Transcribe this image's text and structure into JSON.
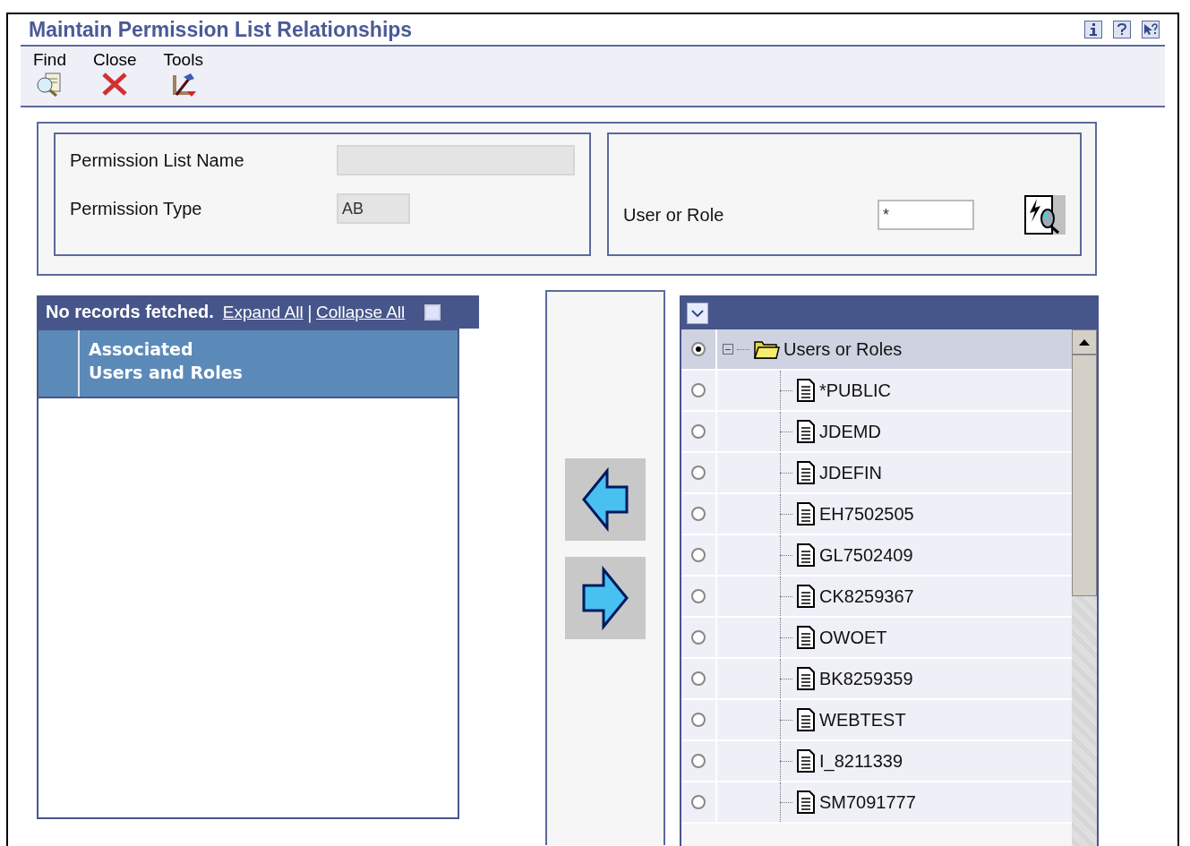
{
  "window": {
    "title": "Maintain Permission List Relationships"
  },
  "header_icons": [
    {
      "kind": "info"
    },
    {
      "kind": "help"
    },
    {
      "kind": "whats-this"
    }
  ],
  "toolbar": [
    {
      "label": "Find",
      "kind": "find"
    },
    {
      "label": "Close",
      "kind": "close"
    },
    {
      "label": "Tools",
      "kind": "tools"
    }
  ],
  "form": {
    "permission_list_name": {
      "label": "Permission List Name",
      "disabled": true
    },
    "permission_type": {
      "label": "Permission Type",
      "value": "AB",
      "disabled": true
    },
    "user_or_role": {
      "label": "User or Role",
      "value": "*"
    }
  },
  "grid": {
    "status": "No records fetched.",
    "links": [
      "Expand All",
      "Collapse All"
    ],
    "separator": "|",
    "columns": [
      "Associated\nUsers and Roles"
    ]
  },
  "tree": {
    "label": "Users or Roles",
    "selected": true,
    "expanded": true,
    "children": [
      {
        "label": "*PUBLIC",
        "selected": false
      },
      {
        "label": "JDEMD",
        "selected": false
      },
      {
        "label": "JDEFIN",
        "selected": false
      },
      {
        "label": "EH7502505",
        "selected": false
      },
      {
        "label": "GL7502409",
        "selected": false
      },
      {
        "label": "CK8259367",
        "selected": false
      },
      {
        "label": "OWOET",
        "selected": false
      },
      {
        "label": "BK8259359",
        "selected": false
      },
      {
        "label": "WEBTEST",
        "selected": false
      },
      {
        "label": "I_8211339",
        "selected": false
      },
      {
        "label": "SM7091777",
        "selected": false
      }
    ]
  }
}
